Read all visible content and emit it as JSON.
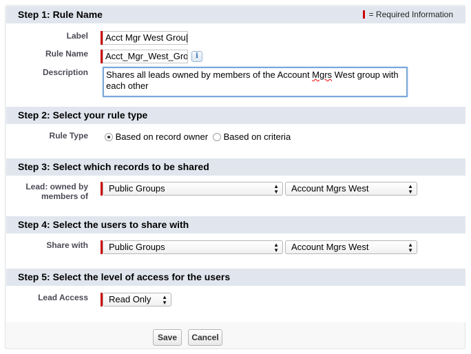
{
  "step1": {
    "title": "Step 1: Rule Name",
    "required_legend": "= Required Information",
    "label_label": "Label",
    "label_value": "Acct Mgr West Grou|",
    "rule_name_label": "Rule Name",
    "rule_name_value": "Acct_Mgr_West_Grou",
    "description_label": "Description",
    "description_pre": "Shares all leads owned by members of the Account ",
    "description_misspelled": "Mgrs",
    "description_post": " West group with each other"
  },
  "step2": {
    "title": "Step 2: Select your rule type",
    "rule_type_label": "Rule Type",
    "option_owner": "Based on record owner",
    "option_criteria": "Based on criteria",
    "selected": "owner"
  },
  "step3": {
    "title": "Step 3: Select which records to be shared",
    "field_label_line1": "Lead: owned by",
    "field_label_line2": "members of",
    "select_type": "Public Groups",
    "select_group": "Account Mgrs West"
  },
  "step4": {
    "title": "Step 4: Select the users to share with",
    "share_with_label": "Share with",
    "select_type": "Public Groups",
    "select_group": "Account Mgrs West"
  },
  "step5": {
    "title": "Step 5: Select the level of access for the users",
    "lead_access_label": "Lead Access",
    "select_access": "Read Only"
  },
  "buttons": {
    "save": "Save",
    "cancel": "Cancel"
  },
  "colors": {
    "required": "#cc0000",
    "header_bg": "#e1e6ee",
    "focus_border": "#7aa7d8"
  }
}
